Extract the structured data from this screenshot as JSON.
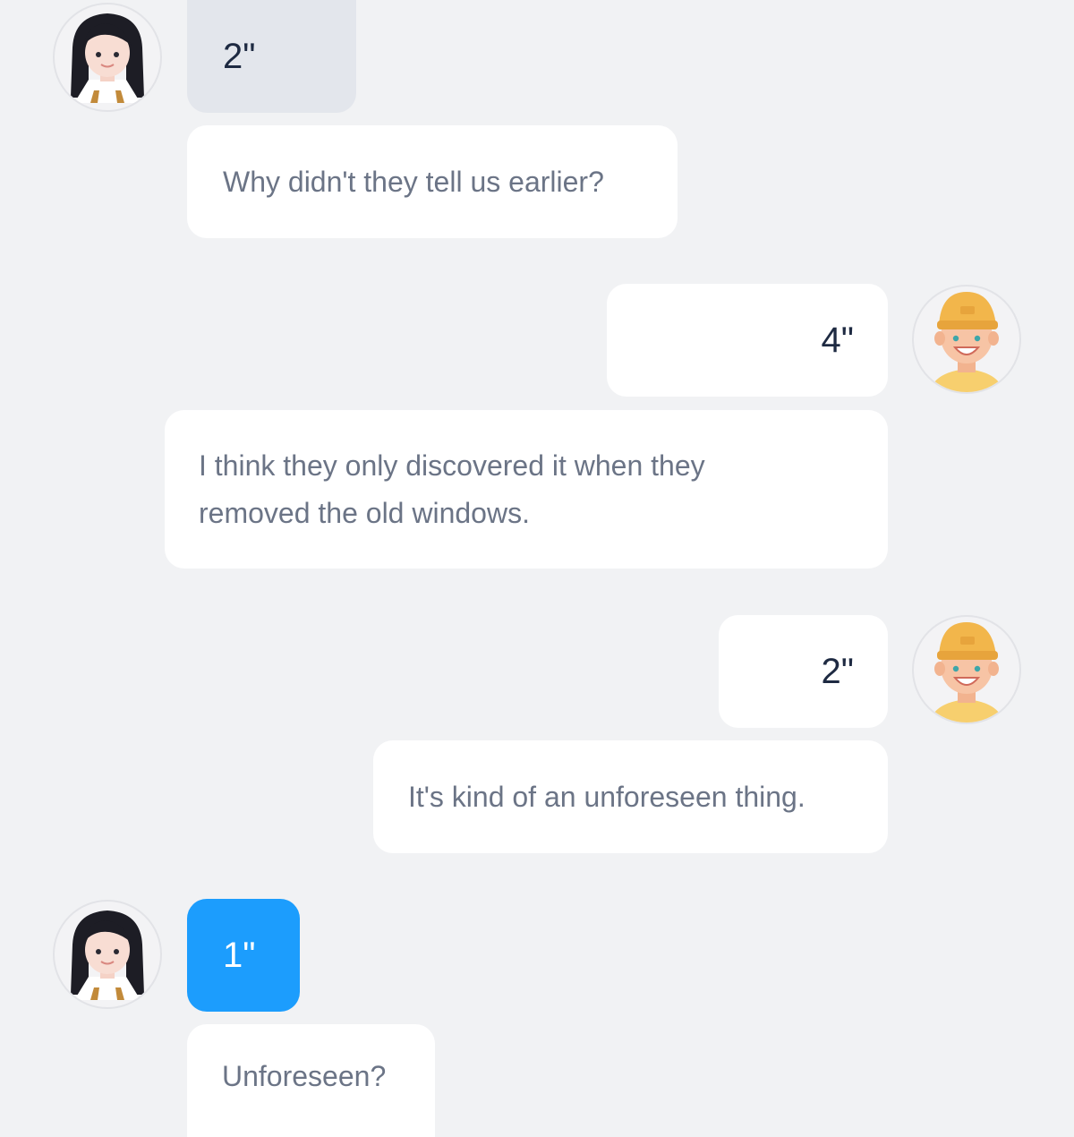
{
  "conversation": {
    "items": [
      {
        "speaker": "woman",
        "duration": "2\"",
        "text": "Why didn't they tell us earlier?"
      },
      {
        "speaker": "man",
        "duration": "4\"",
        "text": "I think they only discovered it when they removed the old windows."
      },
      {
        "speaker": "man",
        "duration": "2\"",
        "text": "It's kind of an unforeseen thing."
      },
      {
        "speaker": "woman",
        "duration": "1\"",
        "text": "Unforeseen?"
      }
    ]
  },
  "icons": {
    "woman_avatar": "woman-avatar-icon",
    "man_avatar": "man-avatar-icon"
  },
  "colors": {
    "background": "#f1f2f4",
    "bubble": "#ffffff",
    "played_duration": "#e3e6ec",
    "active_duration": "#1c9dfd",
    "message_text": "#6b7486",
    "duration_text": "#1e2a42"
  }
}
